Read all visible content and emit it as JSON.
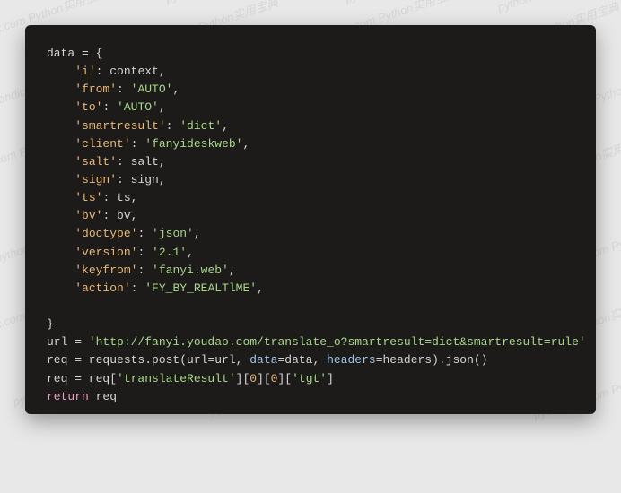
{
  "watermark": "pythondict.com  Python实用宝典",
  "code": {
    "l1": "data = {",
    "entries": [
      {
        "k": "'i'",
        "v": "context",
        "vtype": "var"
      },
      {
        "k": "'from'",
        "v": "'AUTO'",
        "vtype": "str"
      },
      {
        "k": "'to'",
        "v": "'AUTO'",
        "vtype": "str"
      },
      {
        "k": "'smartresult'",
        "v": "'dict'",
        "vtype": "str"
      },
      {
        "k": "'client'",
        "v": "'fanyideskweb'",
        "vtype": "str"
      },
      {
        "k": "'salt'",
        "v": "salt",
        "vtype": "var"
      },
      {
        "k": "'sign'",
        "v": "sign",
        "vtype": "var"
      },
      {
        "k": "'ts'",
        "v": "ts",
        "vtype": "var"
      },
      {
        "k": "'bv'",
        "v": "bv",
        "vtype": "var"
      },
      {
        "k": "'doctype'",
        "v": "'json'",
        "vtype": "str"
      },
      {
        "k": "'version'",
        "v": "'2.1'",
        "vtype": "str"
      },
      {
        "k": "'keyfrom'",
        "v": "'fanyi.web'",
        "vtype": "str"
      },
      {
        "k": "'action'",
        "v": "'FY_BY_REALTlME'",
        "vtype": "str"
      }
    ],
    "close": "}",
    "url_lhs": "url = ",
    "url_val": "'http://fanyi.youdao.com/translate_o?smartresult=dict&smartresult=rule'",
    "req1_a": "req = requests.post(url",
    "req1_b": "=url, ",
    "req1_c": "data",
    "req1_d": "=data, ",
    "req1_e": "headers",
    "req1_f": "=headers).json()",
    "req2_a": "req = req[",
    "req2_b": "'translateResult'",
    "req2_c": "][",
    "req2_d": "0",
    "req2_e": "][",
    "req2_f": "0",
    "req2_g": "][",
    "req2_h": "'tgt'",
    "req2_i": "]",
    "ret_kw": "return",
    "ret_v": " req"
  }
}
